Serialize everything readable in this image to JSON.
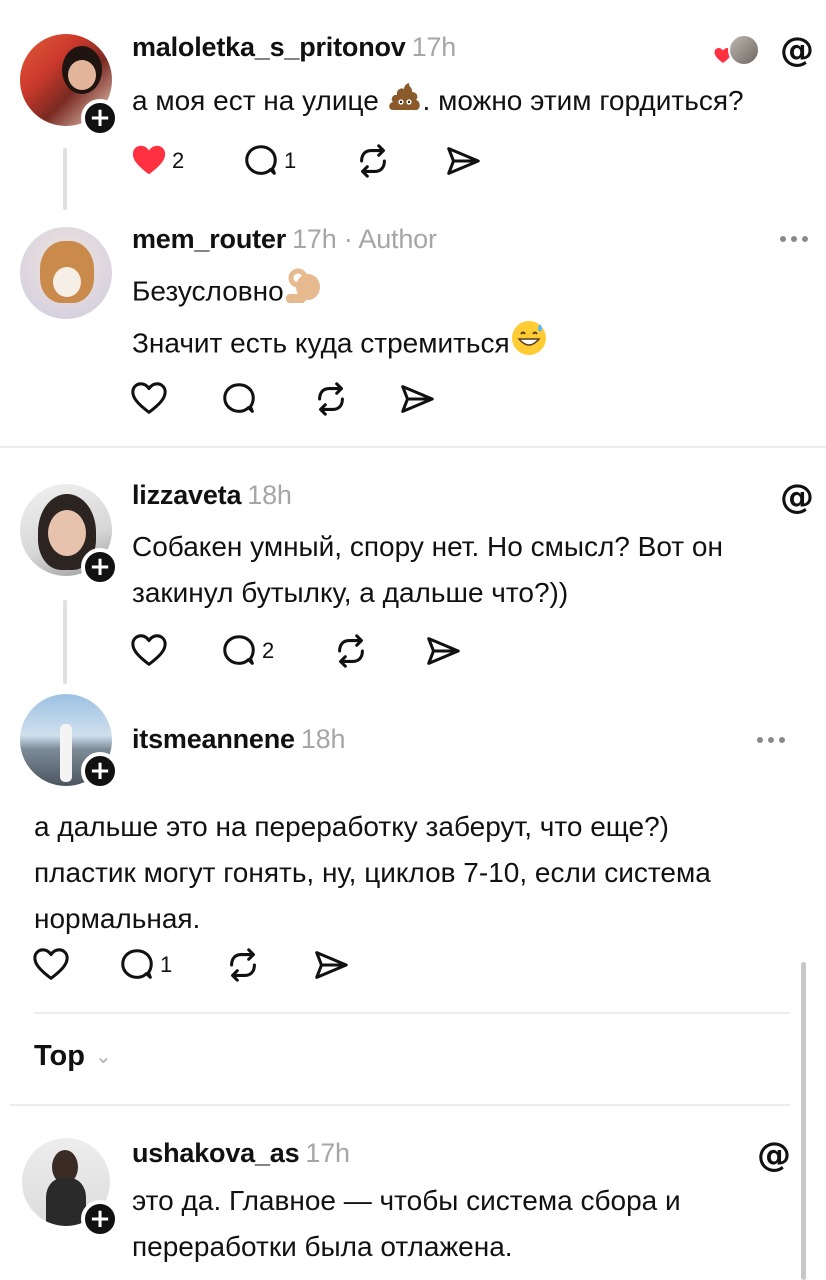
{
  "posts": [
    {
      "username": "maloletka_s_pritonov",
      "time": "17h",
      "text": "а моя ест на улице",
      "text_after_emoji": ". можно этим гордиться?",
      "likes": "2",
      "replies": "1",
      "liked": true
    },
    {
      "username": "mem_router",
      "time": "17h",
      "author": " · Author",
      "line1": "Безусловно",
      "line2": "Значит есть куда стремиться"
    },
    {
      "username": "lizzaveta",
      "time": "18h",
      "line1": "Собакен умный, спору нет. Но смысл? Вот он",
      "line2": "закинул бутылку, а дальше что?))",
      "replies": "2"
    },
    {
      "username": "itsmeannene",
      "time": "18h",
      "line1": "а дальше это на переработку заберут, что еще?)",
      "line2": "пластик могут гонять, ну, циклов 7-10, если система",
      "line3": "нормальная.",
      "replies": "1"
    },
    {
      "username": "ushakova_as",
      "time": "17h",
      "line1": "это да. Главное — чтобы система сбора и",
      "line2": "переработки была отлажена."
    }
  ],
  "sort": {
    "label": "Top"
  },
  "icons": [
    "heart-icon",
    "comment-icon",
    "repost-icon",
    "share-icon",
    "threads-logo-icon",
    "more-icon",
    "follow-plus-icon"
  ],
  "colors": {
    "like_red": "#ff3040",
    "muted": "#a6a6a6"
  }
}
